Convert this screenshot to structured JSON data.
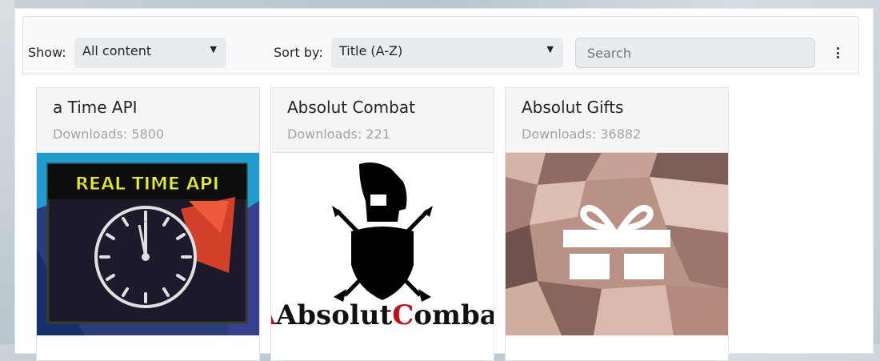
{
  "toolbar": {
    "show_label": "Show:",
    "show_value": "All content",
    "sort_label": "Sort by:",
    "sort_value": "Title (A-Z)",
    "search_placeholder": "Search",
    "more_icon": "kebab-menu-icon"
  },
  "cards": [
    {
      "title": "a Time API",
      "downloads": "Downloads: 5800",
      "image_text": "REAL TIME API",
      "image_icon": "clock-icon"
    },
    {
      "title": "Absolut Combat",
      "downloads": "Downloads: 221",
      "image_text_a": "Absolut",
      "image_text_b": "Combat",
      "image_icon": "spartan-shield-icon"
    },
    {
      "title": "Absolut Gifts",
      "downloads": "Downloads: 36882",
      "image_icon": "gift-icon"
    }
  ],
  "colors": {
    "accent_red": "#c0111a",
    "clock_label_yellow": "#e7f01b"
  }
}
